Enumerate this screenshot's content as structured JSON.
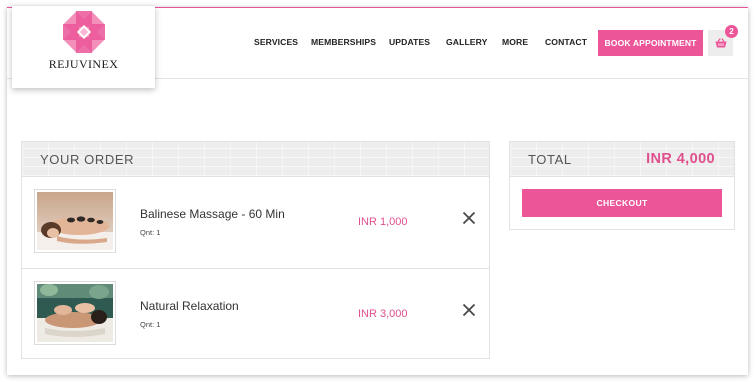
{
  "brand": {
    "name": "REJUVINEX",
    "logo_icon": "lotus-flower-icon",
    "accent_color": "#ec5699"
  },
  "nav": {
    "items": [
      "SERVICES",
      "MEMBERSHIPS",
      "UPDATES",
      "GALLERY",
      "MORE",
      "CONTACT"
    ],
    "book_label": "BOOK APPOINTMENT",
    "cart_icon": "shopping-basket-icon",
    "cart_count": "2"
  },
  "order": {
    "title": "YOUR ORDER",
    "items": [
      {
        "name": "Balinese Massage - 60 Min",
        "qty": "Qnt: 1",
        "price": "INR 1,000",
        "image_icon": "hot-stone-massage-photo",
        "remove_icon": "close-icon"
      },
      {
        "name": "Natural Relaxation",
        "qty": "Qnt: 1",
        "price": "INR 3,000",
        "image_icon": "back-massage-photo",
        "remove_icon": "close-icon"
      }
    ]
  },
  "summary": {
    "total_label": "TOTAL",
    "total_value": "INR 4,000",
    "checkout_label": "CHECKOUT"
  }
}
